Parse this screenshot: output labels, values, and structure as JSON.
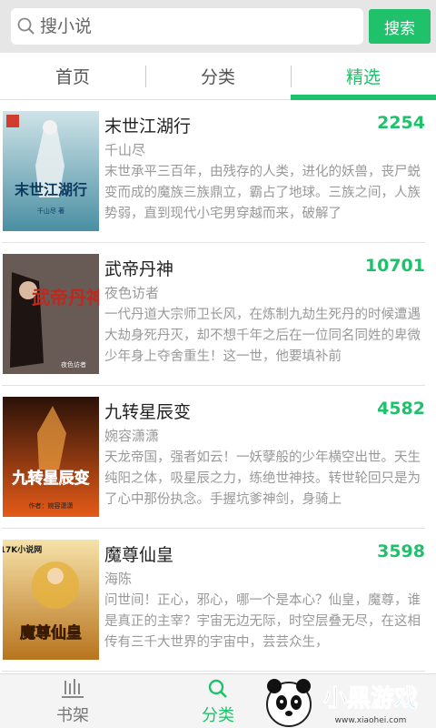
{
  "search": {
    "placeholder": "搜小说",
    "button_label": "搜索"
  },
  "tabs": [
    {
      "label": "首页",
      "active": false
    },
    {
      "label": "分类",
      "active": false
    },
    {
      "label": "精选",
      "active": true
    }
  ],
  "books": [
    {
      "title": "末世江湖行",
      "count": "2254",
      "author": "千山尽",
      "description": "末世承平三百年，由残存的人类，进化的妖兽，丧尸蜕变而成的魔族三族鼎立，霸占了地球。三族之间，人族势弱，直到现代小宅男穿越而来，破解了",
      "cover_text": "末世江湖行",
      "cover_sub": "千山尽 著"
    },
    {
      "title": "武帝丹神",
      "count": "10701",
      "author": "夜色访者",
      "description": "一代丹道大宗师卫长风，在炼制九劫生死丹的时候遭遇大劫身死丹灭，却不想千年之后在一位同名同姓的卑微少年身上夺舍重生！这一世，他要填补前",
      "cover_text": "武帝丹神",
      "cover_sub": "夜色访者"
    },
    {
      "title": "九转星辰变",
      "count": "4582",
      "author": "婉容潇潇",
      "description": "天龙帝国，强者如云！一妖孽般的少年横空出世。天生纯阳之体，吸星辰之力，练绝世神技。转世轮回只是为了心中那份执念。手握坑爹神剑，身骑上",
      "cover_text": "九转星辰变",
      "cover_sub": "作者：婉容潇潇"
    },
    {
      "title": "魔尊仙皇",
      "count": "3598",
      "author": "海陈",
      "description": "问世间！正心，邪心，哪一个是本心？仙皇，魔尊，谁是真正的主宰？宇宙无边无际，时空层叠无尽，在这相传有三千大世界的宇宙中，芸芸众生，",
      "cover_text": "魔尊仙皇",
      "cover_sub": "17K小说网"
    }
  ],
  "bottom_nav": [
    {
      "label": "书架",
      "icon": "bookshelf-icon",
      "active": false
    },
    {
      "label": "分类",
      "icon": "search-icon",
      "active": true
    }
  ],
  "watermark": {
    "brand": "小黑游戏",
    "url": "www.xiaohei.com"
  },
  "colors": {
    "accent": "#1fc16b"
  }
}
